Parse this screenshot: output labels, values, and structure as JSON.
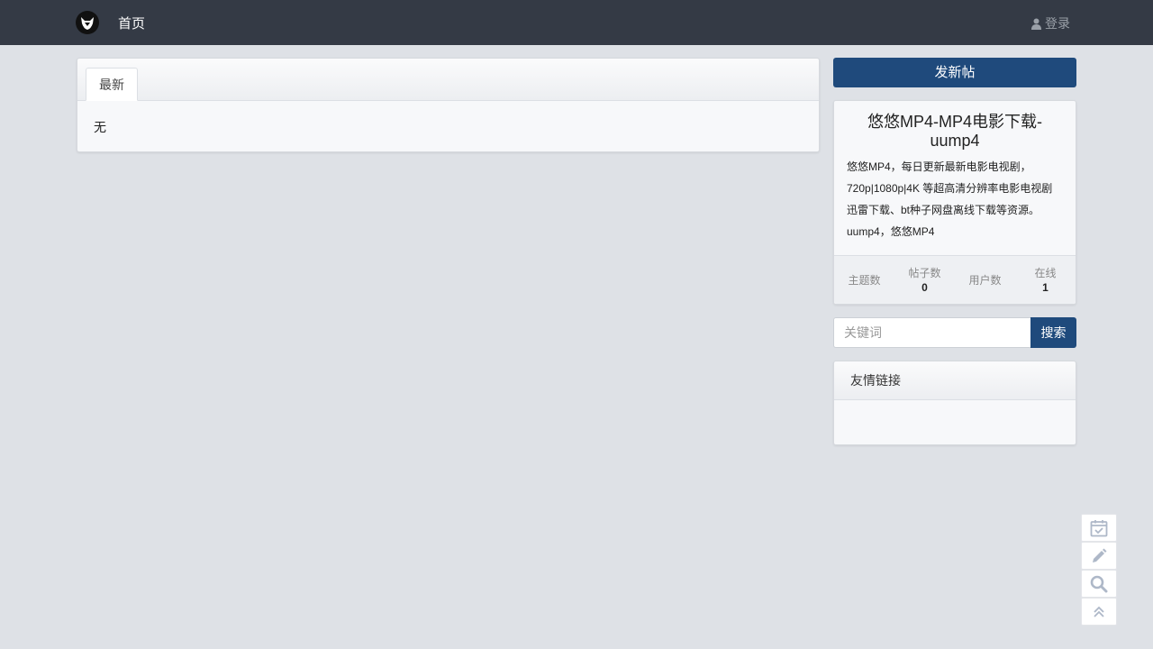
{
  "navbar": {
    "home_label": "首页",
    "login_label": "登录"
  },
  "main": {
    "tab_label": "最新",
    "empty_text": "无"
  },
  "sidebar": {
    "new_post_label": "发新帖",
    "site": {
      "title": "悠悠MP4-MP4电影下载-uump4",
      "description": "悠悠MP4，每日更新最新电影电视剧，720p|1080p|4K 等超高清分辨率电影电视剧迅雷下载、bt种子网盘离线下载等资源。uump4，悠悠MP4",
      "stats": [
        {
          "label": "主题数",
          "value": ""
        },
        {
          "label": "帖子数",
          "value": "0"
        },
        {
          "label": "用户数",
          "value": ""
        },
        {
          "label": "在线",
          "value": "1"
        }
      ]
    },
    "search": {
      "placeholder": "关键词",
      "button_label": "搜索"
    },
    "links_title": "友情链接"
  },
  "colors": {
    "navbar_bg": "#343a45",
    "accent": "#1f4a7c",
    "page_bg": "#dee1e6"
  },
  "float_tools": [
    "calendar-check-icon",
    "pencil-icon",
    "search-icon",
    "double-chevron-up-icon"
  ]
}
